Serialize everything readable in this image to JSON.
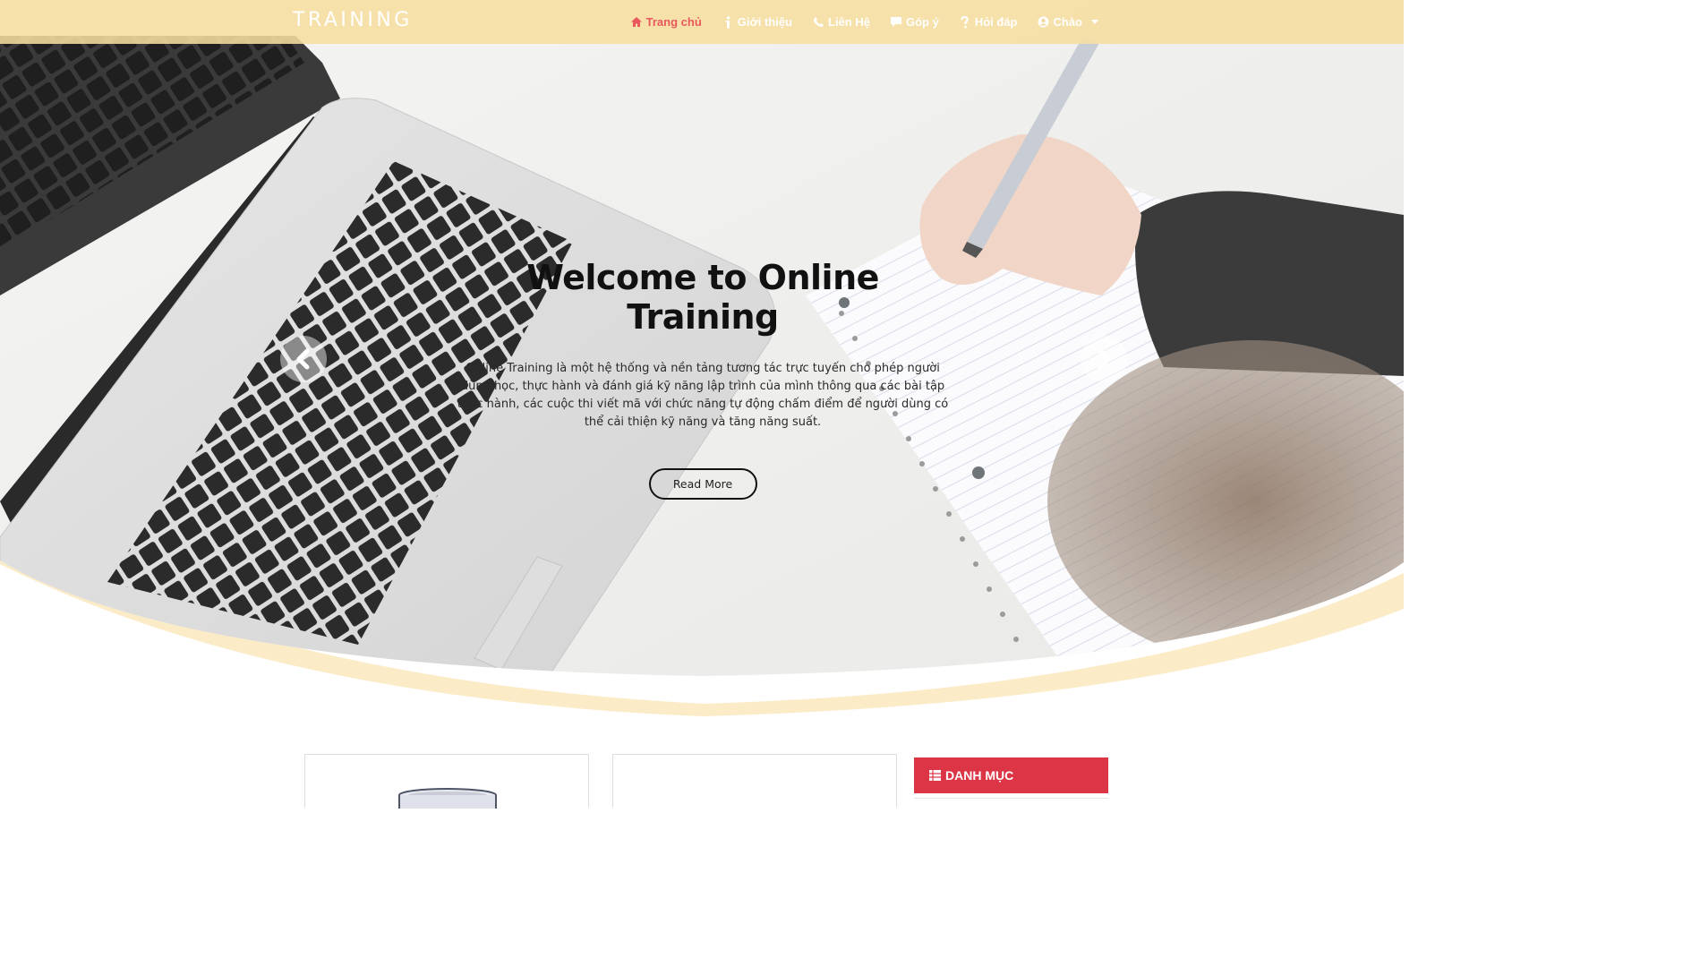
{
  "navbar": {
    "brand": "TRAINING",
    "items": [
      {
        "label": "Trang chủ",
        "icon": "home-icon",
        "active": true
      },
      {
        "label": "Giới thiệu",
        "icon": "info-icon",
        "active": false
      },
      {
        "label": "Liên Hệ",
        "icon": "phone-icon",
        "active": false
      },
      {
        "label": "Góp ý",
        "icon": "comment-icon",
        "active": false
      },
      {
        "label": "Hỏi đáp",
        "icon": "question-icon",
        "active": false
      },
      {
        "label": "Chào",
        "icon": "user-circle-icon",
        "active": false,
        "dropdown": true
      }
    ]
  },
  "hero": {
    "title": "Welcome to Online Training",
    "description": "Online Training là một hệ thống và nền tảng tương tác trực tuyến cho phép người dùng học, thực hành và đánh giá kỹ năng lập trình của mình thông qua các bài tập thực hành, các cuộc thi viết mã với chức năng tự động chấm điểm để người dùng có thể cải thiện kỹ năng và tăng năng suất.",
    "button_label": "Read More",
    "prev_icon": "chevron-left-icon",
    "next_icon": "chevron-right-icon"
  },
  "sidebar": {
    "category_title": "DANH MỤC",
    "category_icon": "table-list-icon"
  },
  "colors": {
    "navbar_bg": "#f7dea0",
    "active_link": "#e8585c",
    "category_header": "#dc3545",
    "wave": "#fcebc7"
  }
}
